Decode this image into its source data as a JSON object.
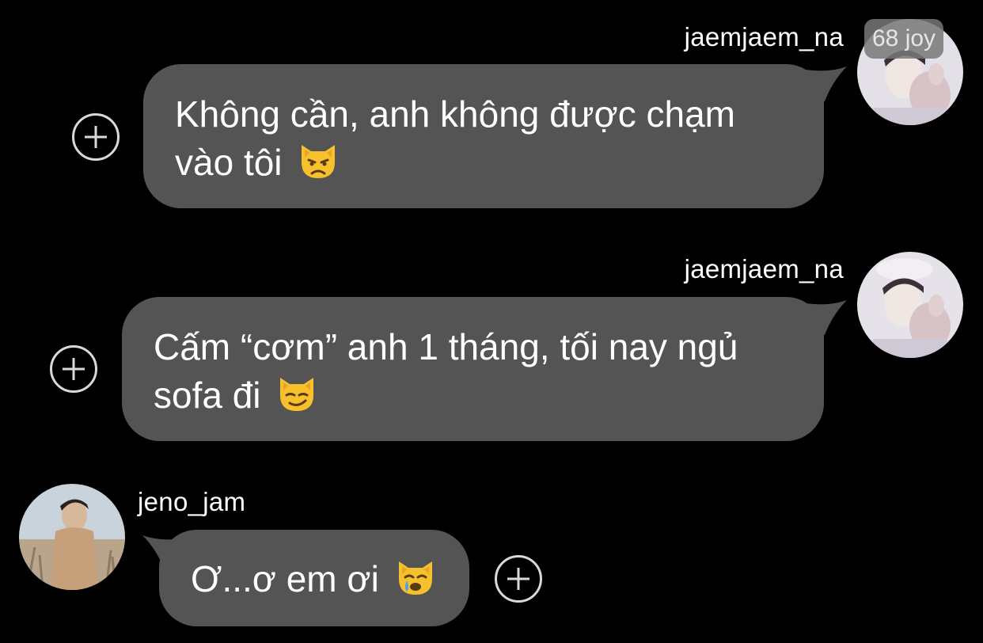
{
  "messages": [
    {
      "sender": "jaemjaem_na",
      "text": "Không cần, anh không được chạm vào tôi",
      "line1": "Không cần, anh không được chạm",
      "line2": "vào tôi",
      "emoji": "pouting-cat-emoji"
    },
    {
      "sender": "jaemjaem_na",
      "text": "Cấm “cơm” anh 1 tháng, tối nay ngủ sofa đi",
      "line1": "Cấm “cơm” anh 1 tháng, tối nay ngủ",
      "line2": "sofa đi",
      "emoji": "smirking-cat-emoji"
    },
    {
      "sender": "jeno_jam",
      "text": "Ơ...ơ em ơi",
      "line1": "Ơ...ơ em ơi",
      "emoji": "crying-cat-emoji"
    }
  ],
  "overlay_badge": "68 joy",
  "colors": {
    "background": "#000000",
    "bubble": "#545454",
    "text": "#ffffff",
    "icon": "#d9d9d9"
  }
}
